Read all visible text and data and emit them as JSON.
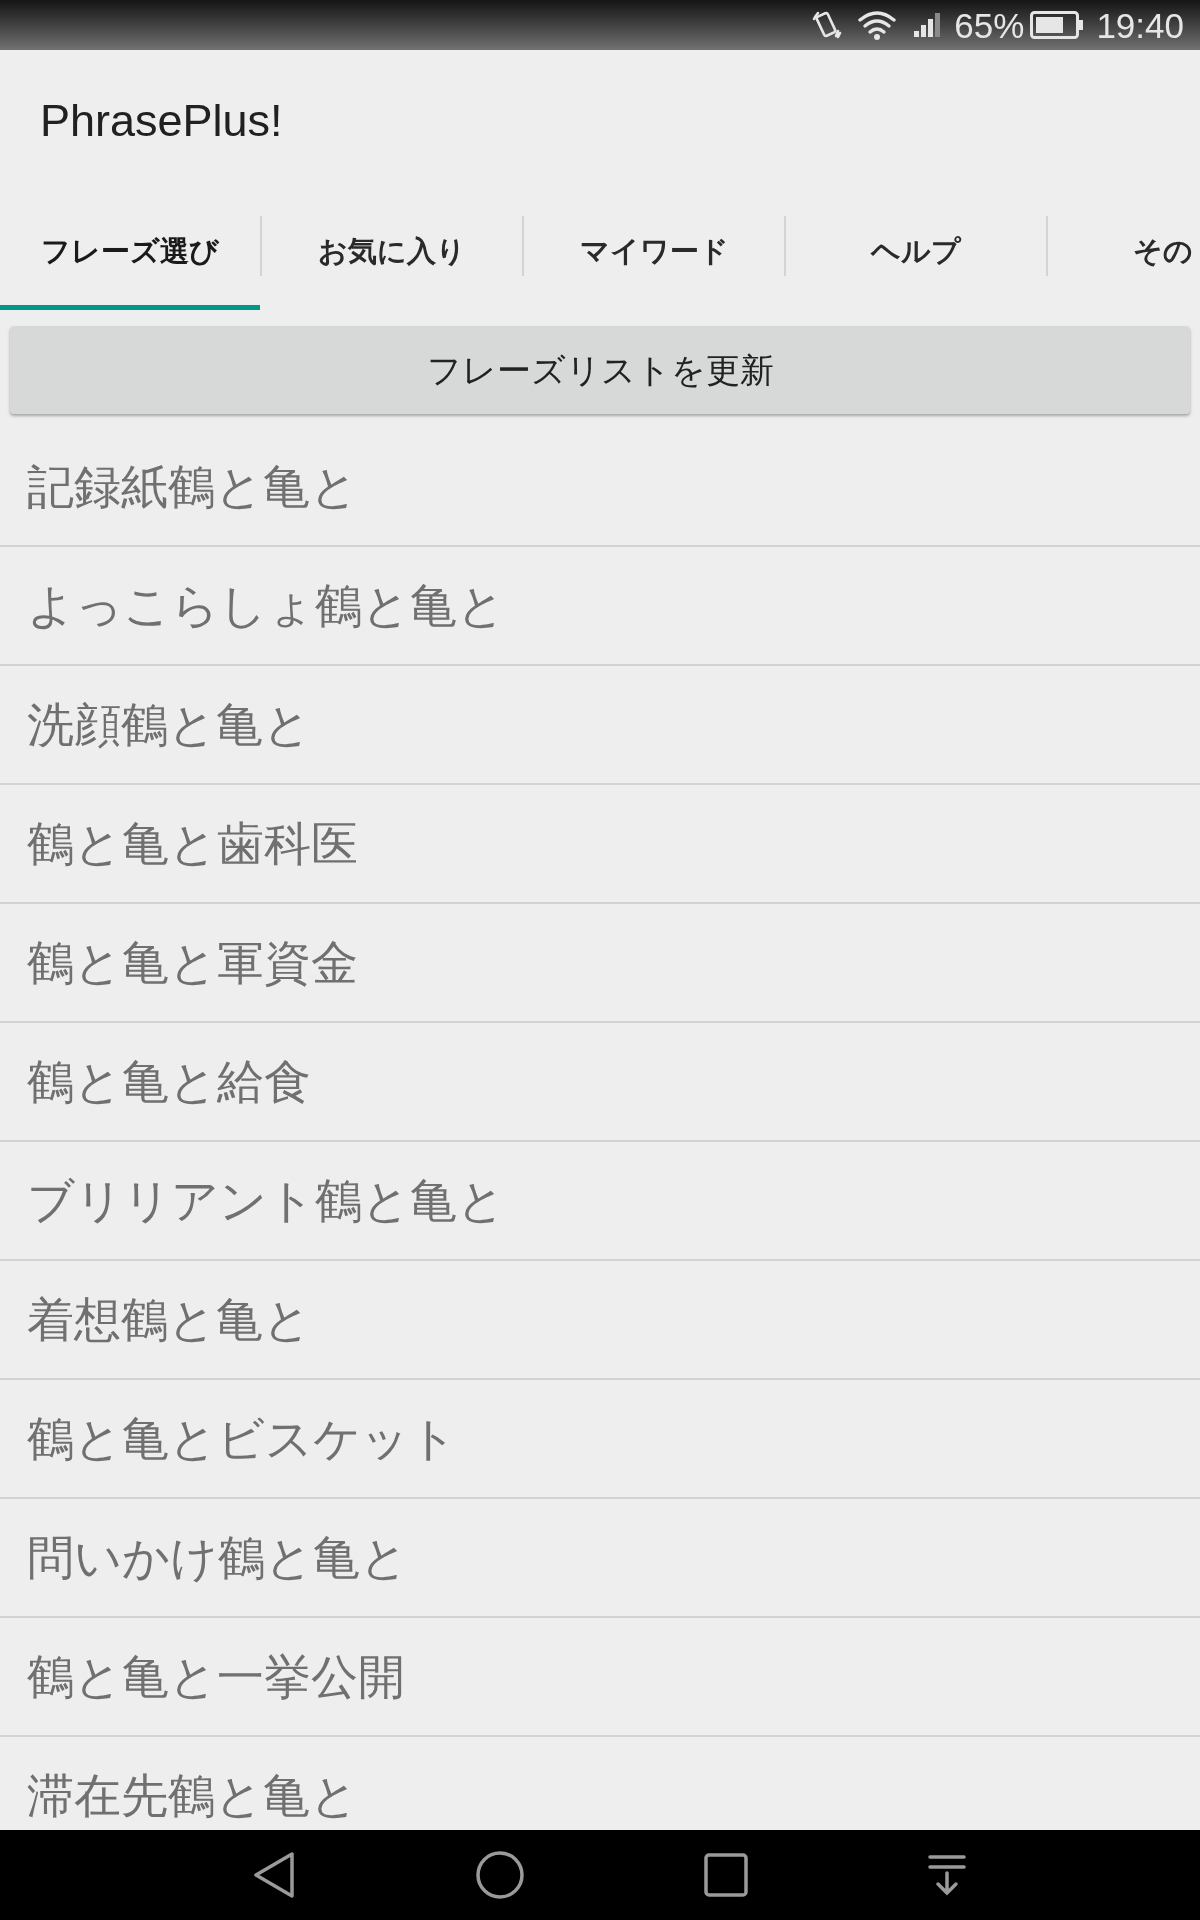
{
  "status_bar": {
    "battery": "65%",
    "time": "19:40"
  },
  "app_bar": {
    "title": "PhrasePlus!"
  },
  "tabs": [
    {
      "label": "フレーズ選び",
      "selected": true
    },
    {
      "label": "お気に入り",
      "selected": false
    },
    {
      "label": "マイワード",
      "selected": false
    },
    {
      "label": "ヘルプ",
      "selected": false
    },
    {
      "label": "その",
      "selected": false
    }
  ],
  "refresh_button": {
    "label": "フレーズリストを更新"
  },
  "phrases": [
    "記録紙鶴と亀と",
    "よっこらしょ鶴と亀と",
    "洗顔鶴と亀と",
    "鶴と亀と歯科医",
    "鶴と亀と軍資金",
    "鶴と亀と給食",
    "ブリリアント鶴と亀と",
    "着想鶴と亀と",
    "鶴と亀とビスケット",
    "問いかけ鶴と亀と",
    "鶴と亀と一挙公開",
    "滞在先鶴と亀と"
  ]
}
